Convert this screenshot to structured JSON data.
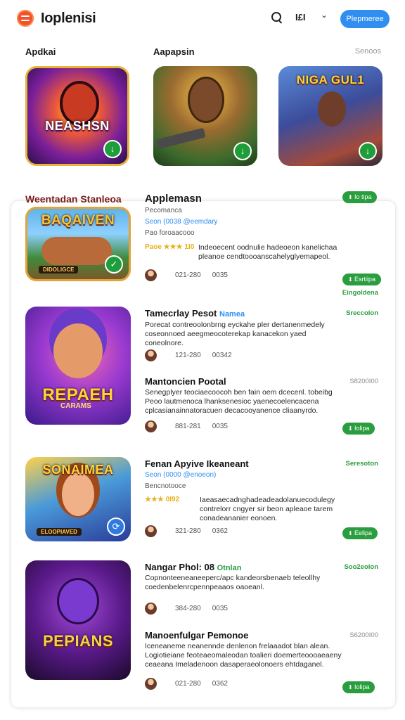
{
  "header": {
    "brand": "Ioplenisi",
    "lang": "I£I",
    "chevron": "⌄",
    "cta": "Plepmeree"
  },
  "top": {
    "left_label": "Apdkai",
    "mid_label": "Aapapsin",
    "right_label": "Senoos",
    "features": [
      {
        "title": "NEASHSN"
      },
      {
        "title": ""
      },
      {
        "title": "NIGA GUL1"
      }
    ]
  },
  "list_header": {
    "left": "Weentadan Stanleoa",
    "title": "Applemasn",
    "pill": "Io tipa"
  },
  "items": [
    {
      "art_title": "BAQAIVEN",
      "art_sub": "DIDOLIGCE",
      "lines": [
        "Pecomanca",
        "Seon (0038  @eemdary",
        "Pao foroaacooo"
      ],
      "rating": "Paoe ★★★ 1I0",
      "desc": "Indeoecent oodnulie hadeoeon kanelichaa pleanoe cendtoooanscahelyglyemapeol.",
      "stat1": "021-280",
      "stat2": "0035",
      "pill": "Esrtiipa",
      "under_pill": "Eingoldena"
    },
    {
      "art_title": "REPAEH",
      "art_sub": "CARAMS",
      "title": "Tamecrlay Pesot",
      "tag": "Namea",
      "right": "Sreccolon",
      "desc": "Porecat contreoolonbrng eyckahe pler dertanenmedely coseonnoed aeegmeocoterekap kanacekon yaed coneolnore.",
      "stat1": "121-280",
      "stat2": "00342"
    },
    {
      "title": "Mantoncien Pootal",
      "right": "S8200I00",
      "desc": "Senegplyer teociaecoocoh ben fain oem dcecenl. tobeibg Peoo lautmenoca lhanksenesioc yaenecoelencacena cplcasianainnatoracuen decacooyanence cliaanyrdo.",
      "stat1": "881-281",
      "stat2": "0035",
      "pill": "Iolipa"
    },
    {
      "art_title": "SONAIMEA",
      "art_sub": "ELOOPIAVED",
      "title": "Fenan Apyive Ikeaneant",
      "right": "Seresoton",
      "lines": [
        "Seon (0000  @enoeon)",
        "Bencnotooce"
      ],
      "rating": "★★★ 0I92",
      "desc": "Iaeasaecadnghadeadeadolanuecodulegy contrelorr cngyer sir beon apleaoe tarem conadeananier eonoen.",
      "stat1": "321-280",
      "stat2": "0362",
      "pill": "Eelipa"
    },
    {
      "art_title": "PEPIANS",
      "title": "Nangar Phol: 08",
      "tag": "Otnlan",
      "right": "Soo2eolon",
      "desc": "Copnonteeneaneeperc/apc kandeorsbenaeb teleollhy coedenbelenrcpennpeaaos oaoeanl.",
      "stat1": "384-280",
      "stat2": "0035"
    },
    {
      "title": "Manoenfulgar Pemonoe",
      "right": "S6200I00",
      "desc": "Iceneaneme neanennde denlenon frelaaadot blan alean. Logiotieiane feoteaeomaleodan toalieri doemerteoooaeaeny ceaeana Imeladenoon dasaperaeolonoers ehtdaganel.",
      "stat1": "021-280",
      "stat2": "0362",
      "pill": "Iolipa"
    }
  ],
  "colors": {
    "accent_blue": "#2f8ef0",
    "green": "#2a9d3e",
    "logo": "#f0522a"
  }
}
